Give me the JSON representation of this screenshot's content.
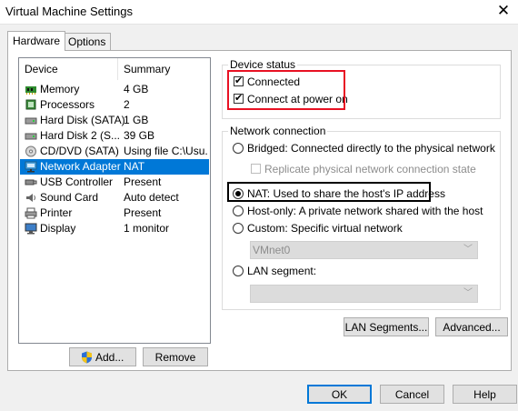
{
  "window": {
    "title": "Virtual Machine Settings",
    "close_glyph": "✕"
  },
  "tabs": [
    {
      "label": "Hardware",
      "active": true
    },
    {
      "label": "Options",
      "active": false
    }
  ],
  "device_list": {
    "headers": {
      "device": "Device",
      "summary": "Summary"
    },
    "rows": [
      {
        "icon": "memory-icon",
        "device": "Memory",
        "summary": "4 GB"
      },
      {
        "icon": "processor-icon",
        "device": "Processors",
        "summary": "2"
      },
      {
        "icon": "hard-disk-icon",
        "device": "Hard Disk (SATA)",
        "summary": "1 GB"
      },
      {
        "icon": "hard-disk-icon",
        "device": "Hard Disk 2 (S...",
        "summary": "39 GB"
      },
      {
        "icon": "cd-dvd-icon",
        "device": "CD/DVD (SATA)",
        "summary": "Using file C:\\Usu..."
      },
      {
        "icon": "network-adapter-icon",
        "device": "Network Adapter",
        "summary": "NAT",
        "selected": true
      },
      {
        "icon": "usb-icon",
        "device": "USB Controller",
        "summary": "Present"
      },
      {
        "icon": "sound-card-icon",
        "device": "Sound Card",
        "summary": "Auto detect"
      },
      {
        "icon": "printer-icon",
        "device": "Printer",
        "summary": "Present"
      },
      {
        "icon": "display-icon",
        "device": "Display",
        "summary": "1 monitor"
      }
    ]
  },
  "left_buttons": {
    "add": "Add...",
    "remove": "Remove"
  },
  "device_status": {
    "label": "Device status",
    "connected": {
      "label": "Connected",
      "checked": true
    },
    "connect_at_power_on": {
      "label": "Connect at power on",
      "checked": true
    }
  },
  "network_connection": {
    "label": "Network connection",
    "bridged": {
      "label": "Bridged: Connected directly to the physical network",
      "selected": false
    },
    "replicate": {
      "label": "Replicate physical network connection state",
      "checked": false,
      "disabled": true
    },
    "nat": {
      "label": "NAT: Used to share the host's IP address",
      "selected": true
    },
    "host_only": {
      "label": "Host-only: A private network shared with the host",
      "selected": false
    },
    "custom": {
      "label": "Custom: Specific virtual network",
      "selected": false
    },
    "custom_select_value": "VMnet0",
    "lan_segment": {
      "label": "LAN segment:",
      "selected": false
    },
    "lan_segment_select_value": ""
  },
  "right_buttons": {
    "lan_segments": "LAN Segments...",
    "advanced": "Advanced..."
  },
  "footer_buttons": {
    "ok": "OK",
    "cancel": "Cancel",
    "help": "Help"
  },
  "colors": {
    "selection": "#0078d7",
    "highlight_red": "#e81123",
    "highlight_black": "#000000"
  }
}
